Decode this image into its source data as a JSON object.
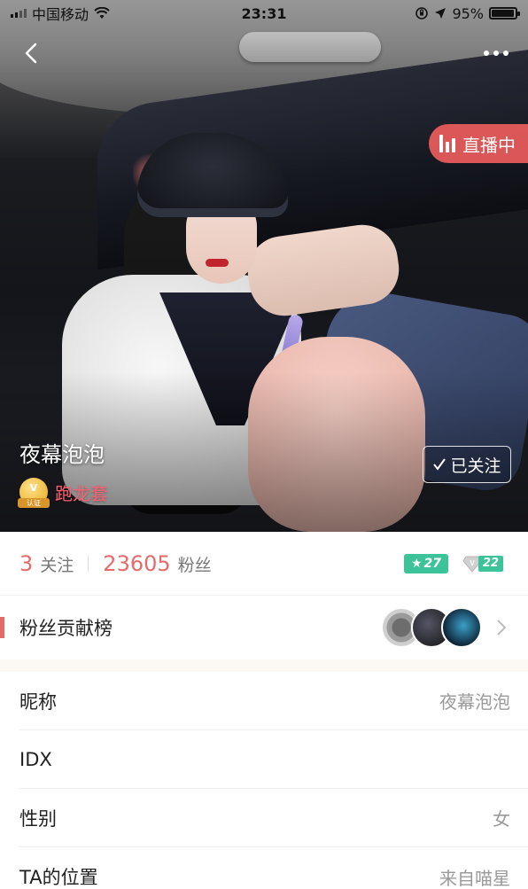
{
  "status_bar": {
    "carrier": "中国移动",
    "time": "23:31",
    "battery": "95%",
    "battery_level": 0.95
  },
  "header": {
    "live_badge": "直播中",
    "nickname": "夜幕泡泡",
    "follow_button": "已关注",
    "cert_label": "跑龙套",
    "cert_ribbon": "认证"
  },
  "stats": {
    "following_count": "3",
    "following_label": "关注",
    "fans_count": "23605",
    "fans_label": "粉丝",
    "star_level": "27",
    "vip_level": "22"
  },
  "fans_contribution": {
    "title": "粉丝贡献榜"
  },
  "info": [
    {
      "label": "昵称",
      "value": "夜幕泡泡"
    },
    {
      "label": "IDX",
      "value": ""
    },
    {
      "label": "性别",
      "value": "女"
    },
    {
      "label": "TA的位置",
      "value": "来自喵星"
    }
  ],
  "colors": {
    "accent": "#e56b6b",
    "live_badge": "#ec5c5c",
    "level_badge": "#3cc39a"
  }
}
